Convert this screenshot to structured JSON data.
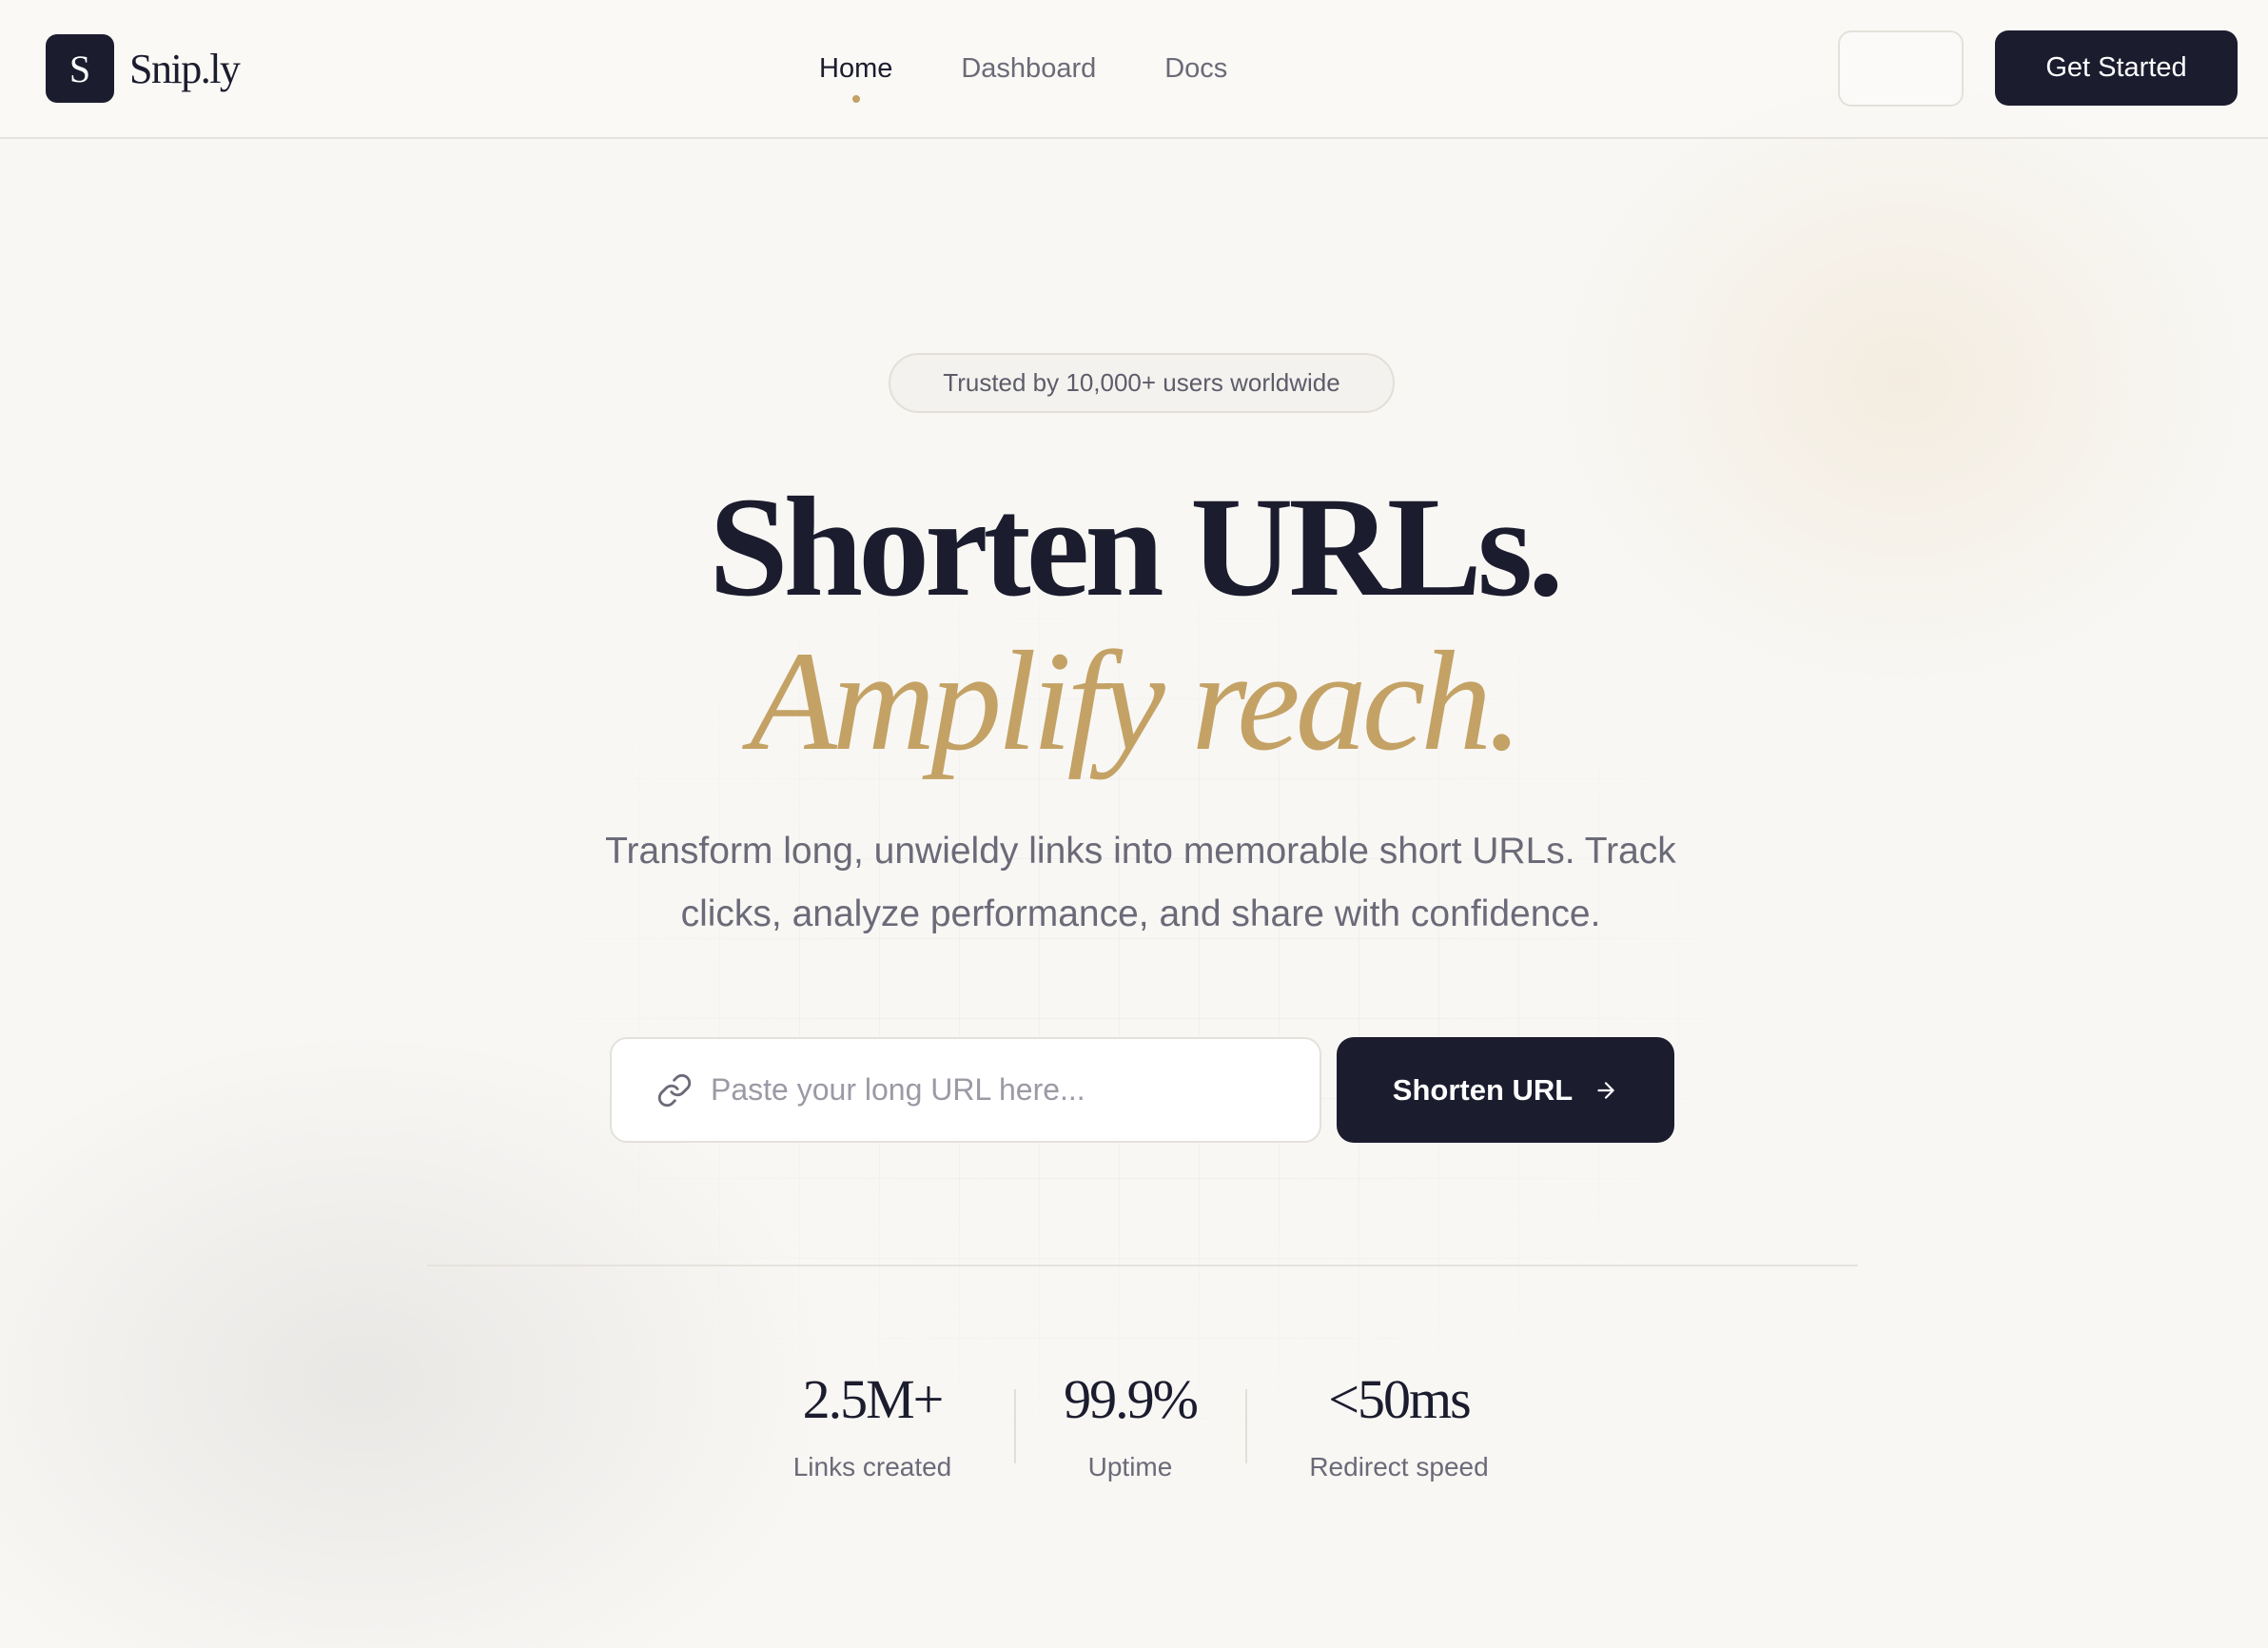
{
  "header": {
    "brand_mark": "S",
    "brand_name": "Snip.ly",
    "nav": [
      {
        "label": "Home",
        "active": true
      },
      {
        "label": "Dashboard",
        "active": false
      },
      {
        "label": "Docs",
        "active": false
      }
    ],
    "cta_label": "Get Started"
  },
  "hero": {
    "badge": "Trusted by 10,000+ users worldwide",
    "headline": "Shorten URLs.",
    "subheadline": "Amplify reach.",
    "description": "Transform long, unwieldy links into memorable short URLs. Track clicks, analyze performance, and share with confidence.",
    "input_placeholder": "Paste your long URL here...",
    "input_icon": "link-icon",
    "button_label": "Shorten URL",
    "button_icon": "arrow-right-icon"
  },
  "stats": [
    {
      "value": "2.5M+",
      "label": "Links created"
    },
    {
      "value": "99.9%",
      "label": "Uptime"
    },
    {
      "value": "<50ms",
      "label": "Redirect speed"
    }
  ],
  "colors": {
    "background": "#f8f7f4",
    "primary": "#1b1c2e",
    "accent_gold": "#c4a265",
    "muted_text": "#6b6a78"
  }
}
